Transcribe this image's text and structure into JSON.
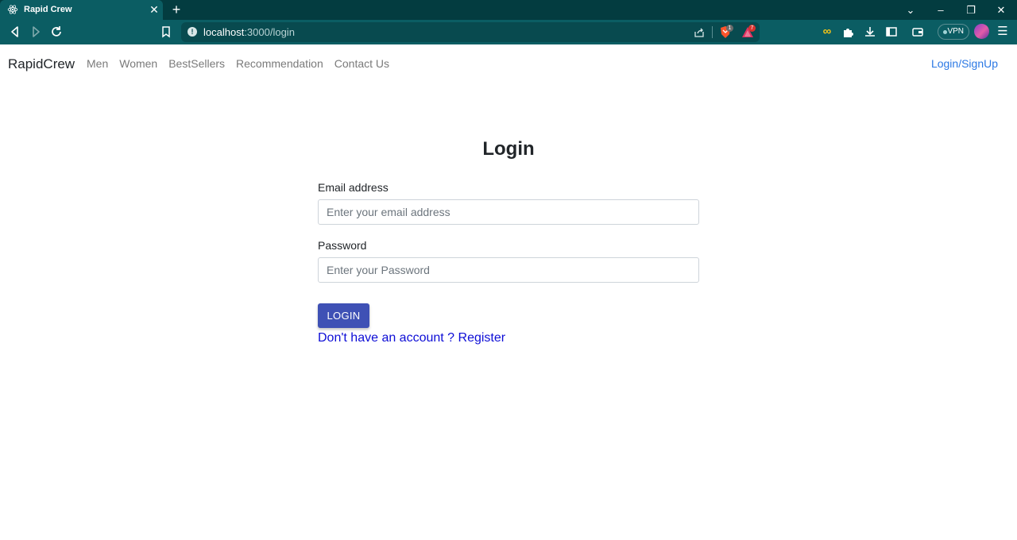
{
  "browser": {
    "tab_title": "Rapid Crew",
    "tab_favicon": "react-icon",
    "url_host": "localhost",
    "url_path": ":3000/login",
    "vpn_label": "VPN",
    "brave_badge": "1",
    "rewards_badge": "7"
  },
  "navbar": {
    "brand": "RapidCrew",
    "links": [
      "Men",
      "Women",
      "BestSellers",
      "Recommendation",
      "Contact Us"
    ],
    "login_link": "Login/SignUp"
  },
  "login": {
    "title": "Login",
    "email_label": "Email address",
    "email_placeholder": "Enter your email address",
    "email_value": "",
    "password_label": "Password",
    "password_placeholder": "Enter your Password",
    "password_value": "",
    "submit_label": "LOGIN",
    "register_text": "Don't have an account ? Register"
  },
  "colors": {
    "browser_chrome": "#0b5d63",
    "tabstrip": "#033c40",
    "primary_button": "#3f51b5",
    "nav_login": "#2b78e4",
    "register_link": "#0d0dd6"
  }
}
